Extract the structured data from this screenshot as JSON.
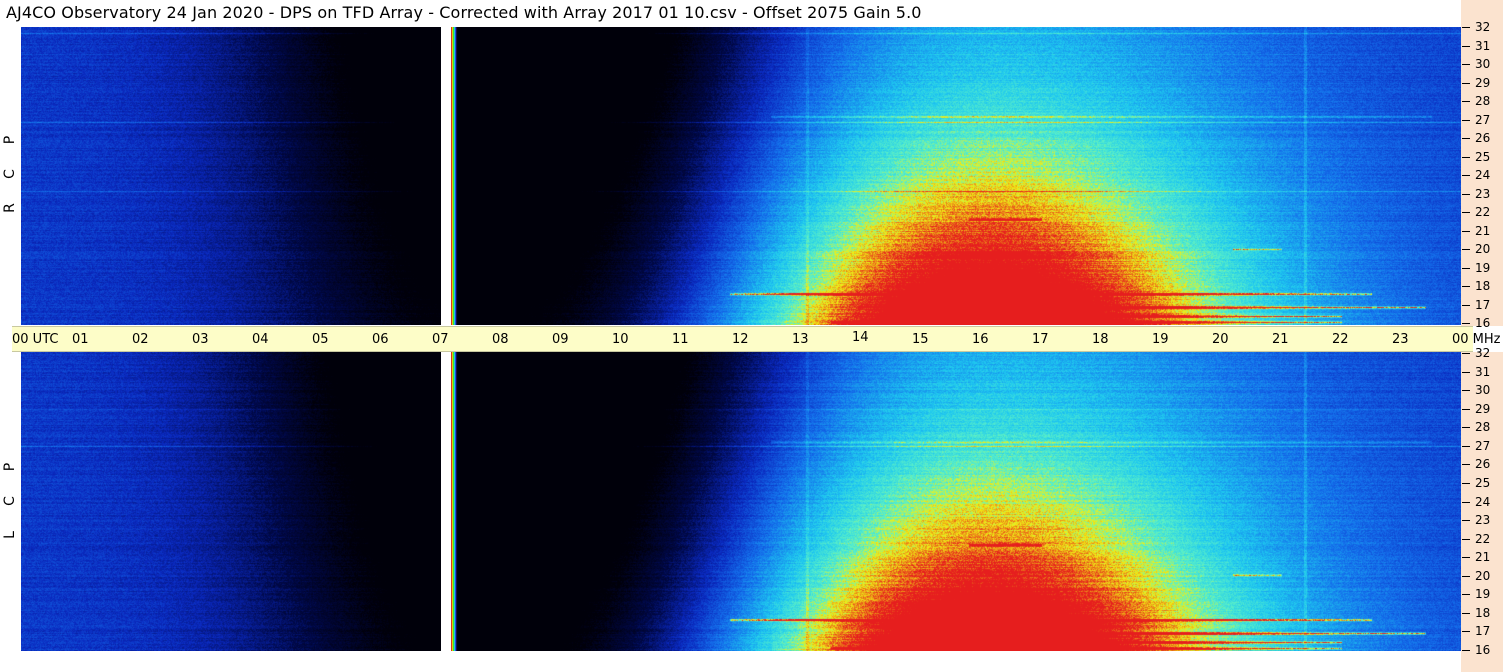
{
  "title": "AJ4CO Observatory  24 Jan 2020  -  DPS on TFD Array  -  Corrected with Array 2017 01 10.csv  -  Offset 2075  Gain 5.0",
  "panels": [
    {
      "id": "rcp",
      "label_letters": [
        "P",
        "C",
        "R"
      ]
    },
    {
      "id": "lcp",
      "label_letters": [
        "P",
        "C",
        "L"
      ]
    }
  ],
  "time_axis": {
    "labels": [
      "00 UTC",
      "01",
      "02",
      "03",
      "04",
      "05",
      "06",
      "07",
      "08",
      "09",
      "10",
      "11",
      "12",
      "13",
      "14",
      "15",
      "16",
      "17",
      "18",
      "19",
      "20",
      "21",
      "22",
      "23",
      "00 MHz"
    ]
  },
  "freq_axis": {
    "labels": [
      "32",
      "31",
      "30",
      "29",
      "28",
      "27",
      "26",
      "25",
      "24",
      "23",
      "22",
      "21",
      "20",
      "19",
      "18",
      "17",
      "16"
    ]
  },
  "colors": {
    "background_deep": "#000820",
    "background_blue": "#0a2cc0",
    "daytime_cyan": "#20e0f0",
    "signal_yellow": "#f0f000",
    "signal_red": "#e02020",
    "timebar": "#fdfdc8",
    "freq_axis_bg": "#fbe3cf"
  },
  "chart_data": {
    "type": "heatmap",
    "title": "AJ4CO Observatory  24 Jan 2020  -  DPS on TFD Array  -  Corrected with Array 2017 01 10.csv  -  Offset 2075  Gain 5.0",
    "xlabel": "UTC",
    "ylabel": "MHz",
    "xlim": [
      0,
      24
    ],
    "ylim": [
      16,
      32
    ],
    "series": [
      {
        "name": "RCP"
      },
      {
        "name": "LCP"
      }
    ],
    "data_gap_utc": [
      7.0,
      7.15
    ]
  }
}
